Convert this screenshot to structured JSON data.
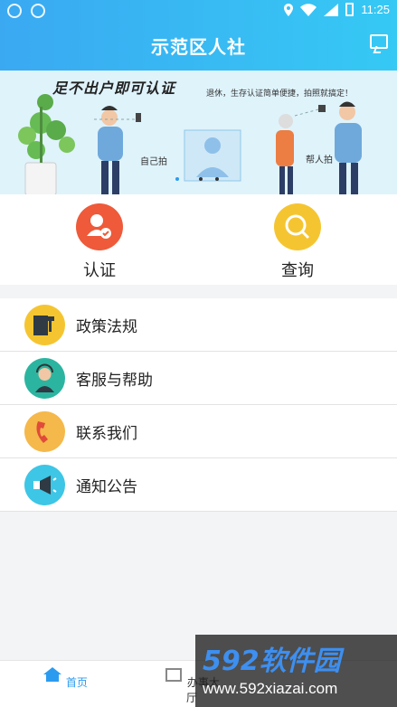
{
  "status_bar": {
    "time": "11:25"
  },
  "header": {
    "title": "示范区人社"
  },
  "banner": {
    "headline": "足不出户即可认证",
    "subline": "退休，生存认证简单便捷，拍照就搞定！",
    "caption_self": "自己拍",
    "caption_help": "帮人拍"
  },
  "quick_actions": [
    {
      "label": "认证",
      "icon": "user-verify-icon",
      "color": "#ee5a3a"
    },
    {
      "label": "查询",
      "icon": "search-icon",
      "color": "#f5c531"
    }
  ],
  "menu": [
    {
      "label": "政策法规",
      "icon": "gavel-book-icon",
      "color": "#f5c531"
    },
    {
      "label": "客服与帮助",
      "icon": "customer-service-icon",
      "color": "#2bb5a0"
    },
    {
      "label": "联系我们",
      "icon": "phone-icon",
      "color": "#f5b84a"
    },
    {
      "label": "通知公告",
      "icon": "megaphone-icon",
      "color": "#3dc6e6"
    }
  ],
  "tabbar": {
    "tabs": [
      {
        "label": "首页",
        "icon": "home-icon"
      },
      {
        "label": "办事大厅",
        "icon": "hall-icon"
      }
    ]
  },
  "watermark": {
    "brand": "592软件园",
    "url": "www.592xiazai.com"
  }
}
